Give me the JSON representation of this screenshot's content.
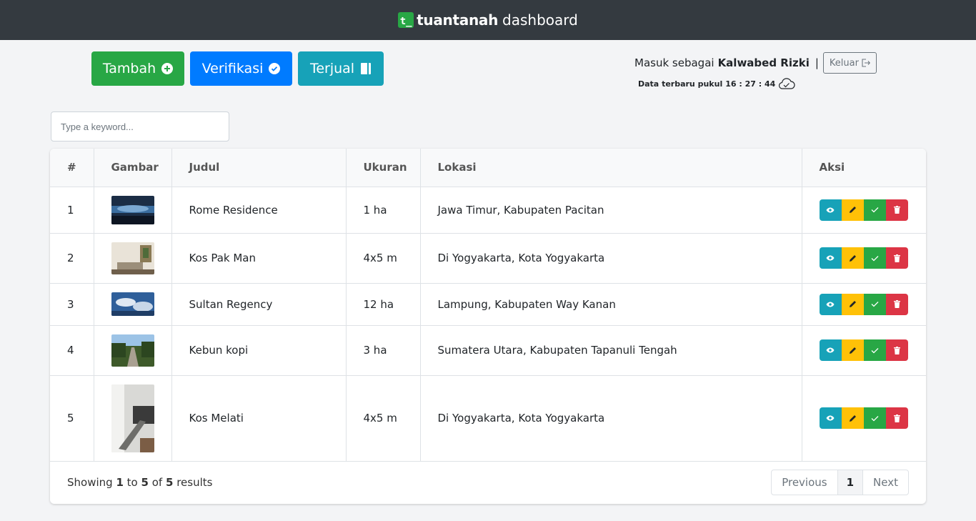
{
  "navbar": {
    "logo_letter": "t_",
    "brand": "tuantanah",
    "suffix": "dashboard"
  },
  "toolbar": {
    "tambah": "Tambah",
    "verifikasi": "Verifikasi",
    "terjual": "Terjual"
  },
  "user": {
    "prefix": "Masuk sebagai",
    "name": "Kalwabed Rizki",
    "separator": "|",
    "logout": "Keluar"
  },
  "update": {
    "label": "Data terbaru pukul",
    "time": "16 : 27 : 44"
  },
  "search": {
    "placeholder": "Type a keyword..."
  },
  "table": {
    "headers": {
      "num": "#",
      "gambar": "Gambar",
      "judul": "Judul",
      "ukuran": "Ukuran",
      "lokasi": "Lokasi",
      "aksi": "Aksi"
    },
    "rows": [
      {
        "num": "1",
        "judul": "Rome Residence",
        "ukuran": "1 ha",
        "lokasi": "Jawa Timur, Kabupaten Pacitan"
      },
      {
        "num": "2",
        "judul": "Kos Pak Man",
        "ukuran": "4x5 m",
        "lokasi": "Di Yogyakarta, Kota Yogyakarta"
      },
      {
        "num": "3",
        "judul": "Sultan Regency",
        "ukuran": "12 ha",
        "lokasi": "Lampung, Kabupaten Way Kanan"
      },
      {
        "num": "4",
        "judul": "Kebun kopi",
        "ukuran": "3 ha",
        "lokasi": "Sumatera Utara, Kabupaten Tapanuli Tengah"
      },
      {
        "num": "5",
        "judul": "Kos Melati",
        "ukuran": "4x5 m",
        "lokasi": "Di Yogyakarta, Kota Yogyakarta"
      }
    ]
  },
  "footer": {
    "showing_prefix": "Showing",
    "from": "1",
    "to_word": "to",
    "to": "5",
    "of_word": "of",
    "total": "5",
    "results_word": "results",
    "prev": "Previous",
    "page": "1",
    "next": "Next"
  },
  "colors": {
    "navbar": "#343a40",
    "success": "#28a745",
    "primary": "#007bff",
    "info": "#17a2b8",
    "warning": "#ffc107",
    "danger": "#dc3545"
  }
}
